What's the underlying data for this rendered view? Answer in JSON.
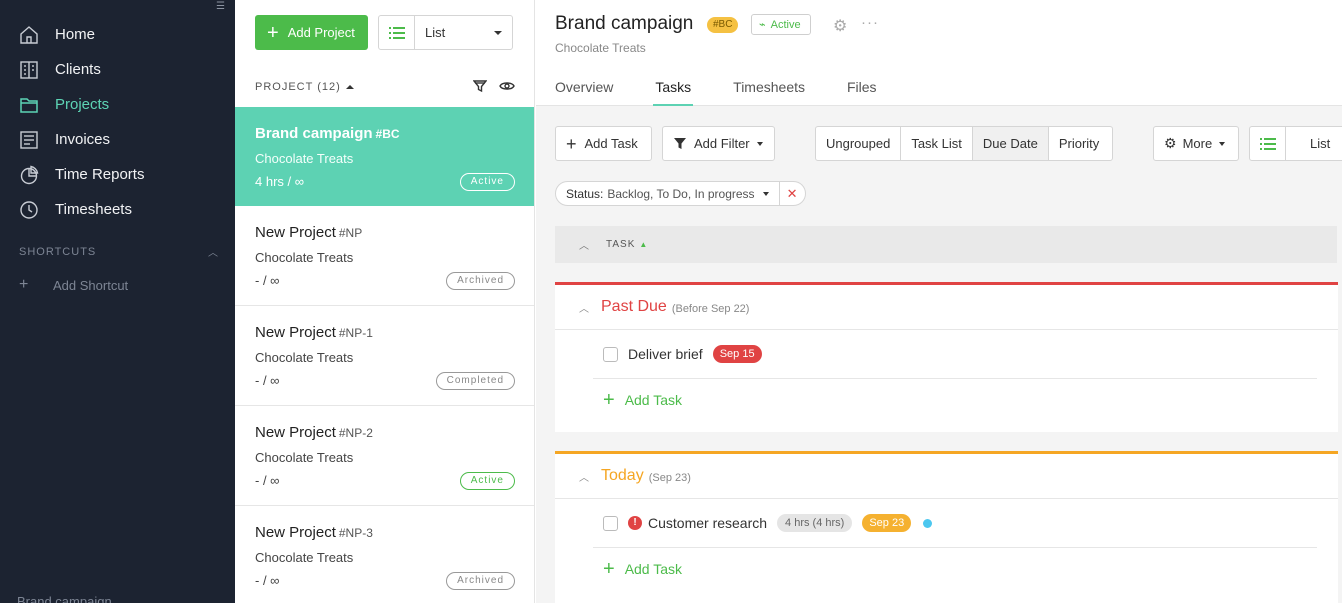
{
  "sidebar": {
    "items": [
      {
        "label": "Home",
        "icon": "home-icon"
      },
      {
        "label": "Clients",
        "icon": "building-icon"
      },
      {
        "label": "Projects",
        "icon": "folder-icon"
      },
      {
        "label": "Invoices",
        "icon": "invoice-icon"
      },
      {
        "label": "Time Reports",
        "icon": "pie-chart-icon"
      },
      {
        "label": "Timesheets",
        "icon": "clock-icon"
      }
    ],
    "active_index": 2,
    "shortcuts_label": "SHORTCUTS",
    "add_shortcut_label": "Add Shortcut",
    "footer_text": "Brand campaign"
  },
  "project_list": {
    "add_project_label": "Add Project",
    "view_label": "List",
    "header_label": "PROJECT (12)",
    "projects": [
      {
        "title": "Brand campaign",
        "code": "#BC",
        "client": "Chocolate Treats",
        "hours": "4 hrs / ∞",
        "status": "Active"
      },
      {
        "title": "New Project",
        "code": "#NP",
        "client": "Chocolate Treats",
        "hours": "- / ∞",
        "status": "Archived"
      },
      {
        "title": "New Project",
        "code": "#NP-1",
        "client": "Chocolate Treats",
        "hours": "- / ∞",
        "status": "Completed"
      },
      {
        "title": "New Project",
        "code": "#NP-2",
        "client": "Chocolate Treats",
        "hours": "- / ∞",
        "status": "Active"
      },
      {
        "title": "New Project",
        "code": "#NP-3",
        "client": "Chocolate Treats",
        "hours": "- / ∞",
        "status": "Archived"
      }
    ]
  },
  "main": {
    "title": "Brand campaign",
    "code_badge": "#BC",
    "status": "Active",
    "subtitle": "Chocolate Treats",
    "tabs": [
      "Overview",
      "Tasks",
      "Timesheets",
      "Files"
    ],
    "active_tab": "Tasks",
    "toolbar": {
      "add_task": "Add Task",
      "add_filter": "Add Filter",
      "grouping": [
        "Ungrouped",
        "Task List",
        "Due Date",
        "Priority"
      ],
      "active_grouping": "Due Date",
      "more": "More",
      "view": "List"
    },
    "filter": {
      "label": "Status:",
      "value": "Backlog, To Do, In progress"
    },
    "task_header": "TASK",
    "groups": [
      {
        "name": "Past Due",
        "sub": "(Before Sep 22)",
        "color": "#e04343",
        "tasks": [
          {
            "name": "Deliver brief",
            "due": "Sep 15",
            "due_color": "#e04343"
          }
        ],
        "add_label": "Add Task"
      },
      {
        "name": "Today",
        "sub": "(Sep 23)",
        "color": "#f5a623",
        "tasks": [
          {
            "name": "Customer research",
            "hours": "4 hrs (4 hrs)",
            "due": "Sep 23",
            "due_color": "#f5b130",
            "alert": true
          }
        ],
        "add_label": "Add Task"
      }
    ]
  },
  "colors": {
    "sidebar_bg": "#1c2331",
    "accent_teal": "#5dd2b3",
    "accent_green": "#4cbb4a",
    "danger": "#e04343",
    "warning": "#f5a623"
  }
}
